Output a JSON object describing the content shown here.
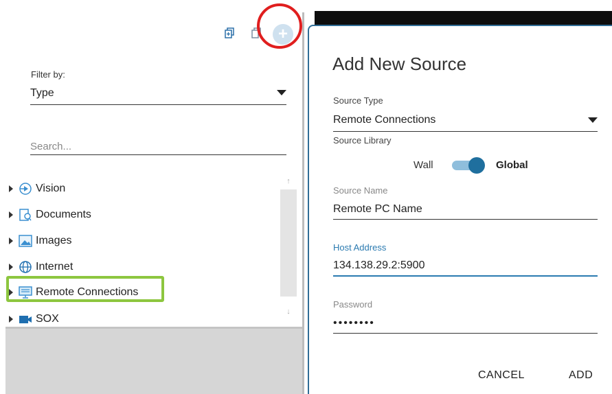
{
  "left_panel": {
    "filter": {
      "label": "Filter by:",
      "value": "Type"
    },
    "search": {
      "placeholder": "Search..."
    },
    "tree_items": [
      {
        "label": "Vision",
        "icon": "play-circle-icon"
      },
      {
        "label": "Documents",
        "icon": "document-icon"
      },
      {
        "label": "Images",
        "icon": "image-icon"
      },
      {
        "label": "Internet",
        "icon": "globe-icon"
      },
      {
        "label": "Remote Connections",
        "icon": "monitor-icon",
        "highlighted": true
      },
      {
        "label": "SOX",
        "icon": "video-camera-icon"
      }
    ],
    "toolbar_icons": [
      "copy-icon",
      "duplicate-icon",
      "add-circle-icon"
    ]
  },
  "dialog": {
    "title": "Add New Source",
    "source_type": {
      "label": "Source Type",
      "value": "Remote Connections"
    },
    "source_library": {
      "label": "Source Library",
      "option_left": "Wall",
      "option_right": "Global",
      "selected": "Global"
    },
    "source_name": {
      "label": "Source Name",
      "value": "Remote PC Name"
    },
    "host_address": {
      "label": "Host Address",
      "value": "134.138.29.2:5900"
    },
    "password": {
      "label": "Password",
      "value": "••••••••"
    },
    "buttons": {
      "cancel": "CANCEL",
      "add": "ADD"
    }
  },
  "colors": {
    "accent_blue": "#2a7ab0",
    "toggle_knob": "#1f6f9e",
    "annotation_red": "#e01e1e",
    "annotation_green": "#8dc63f"
  }
}
